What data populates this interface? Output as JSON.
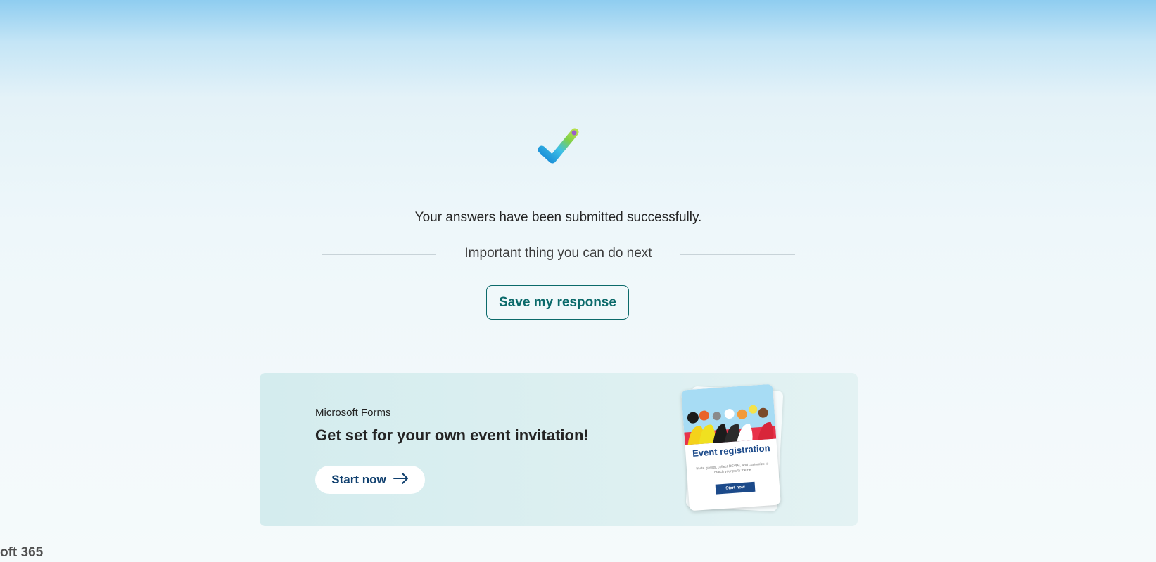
{
  "status": {
    "message": "Your answers have been submitted successfully.",
    "icon": "checkmark-icon"
  },
  "next_steps": {
    "heading": "Important thing you can do next",
    "save_label": "Save my response"
  },
  "promo": {
    "brand": "Microsoft Forms",
    "title": "Get set for your own event invitation!",
    "start_label": "Start now",
    "start_icon": "arrow-right-icon",
    "card": {
      "title": "Event registration",
      "description": "Invite guests, collect RSVPs, and customize to match your party theme",
      "button": "Start now"
    }
  },
  "footer": {
    "brand": "oft 365"
  },
  "colors": {
    "accent_teal": "#0b6a6a",
    "start_text": "#0f3f6e",
    "card_blue": "#1c4a8a"
  }
}
